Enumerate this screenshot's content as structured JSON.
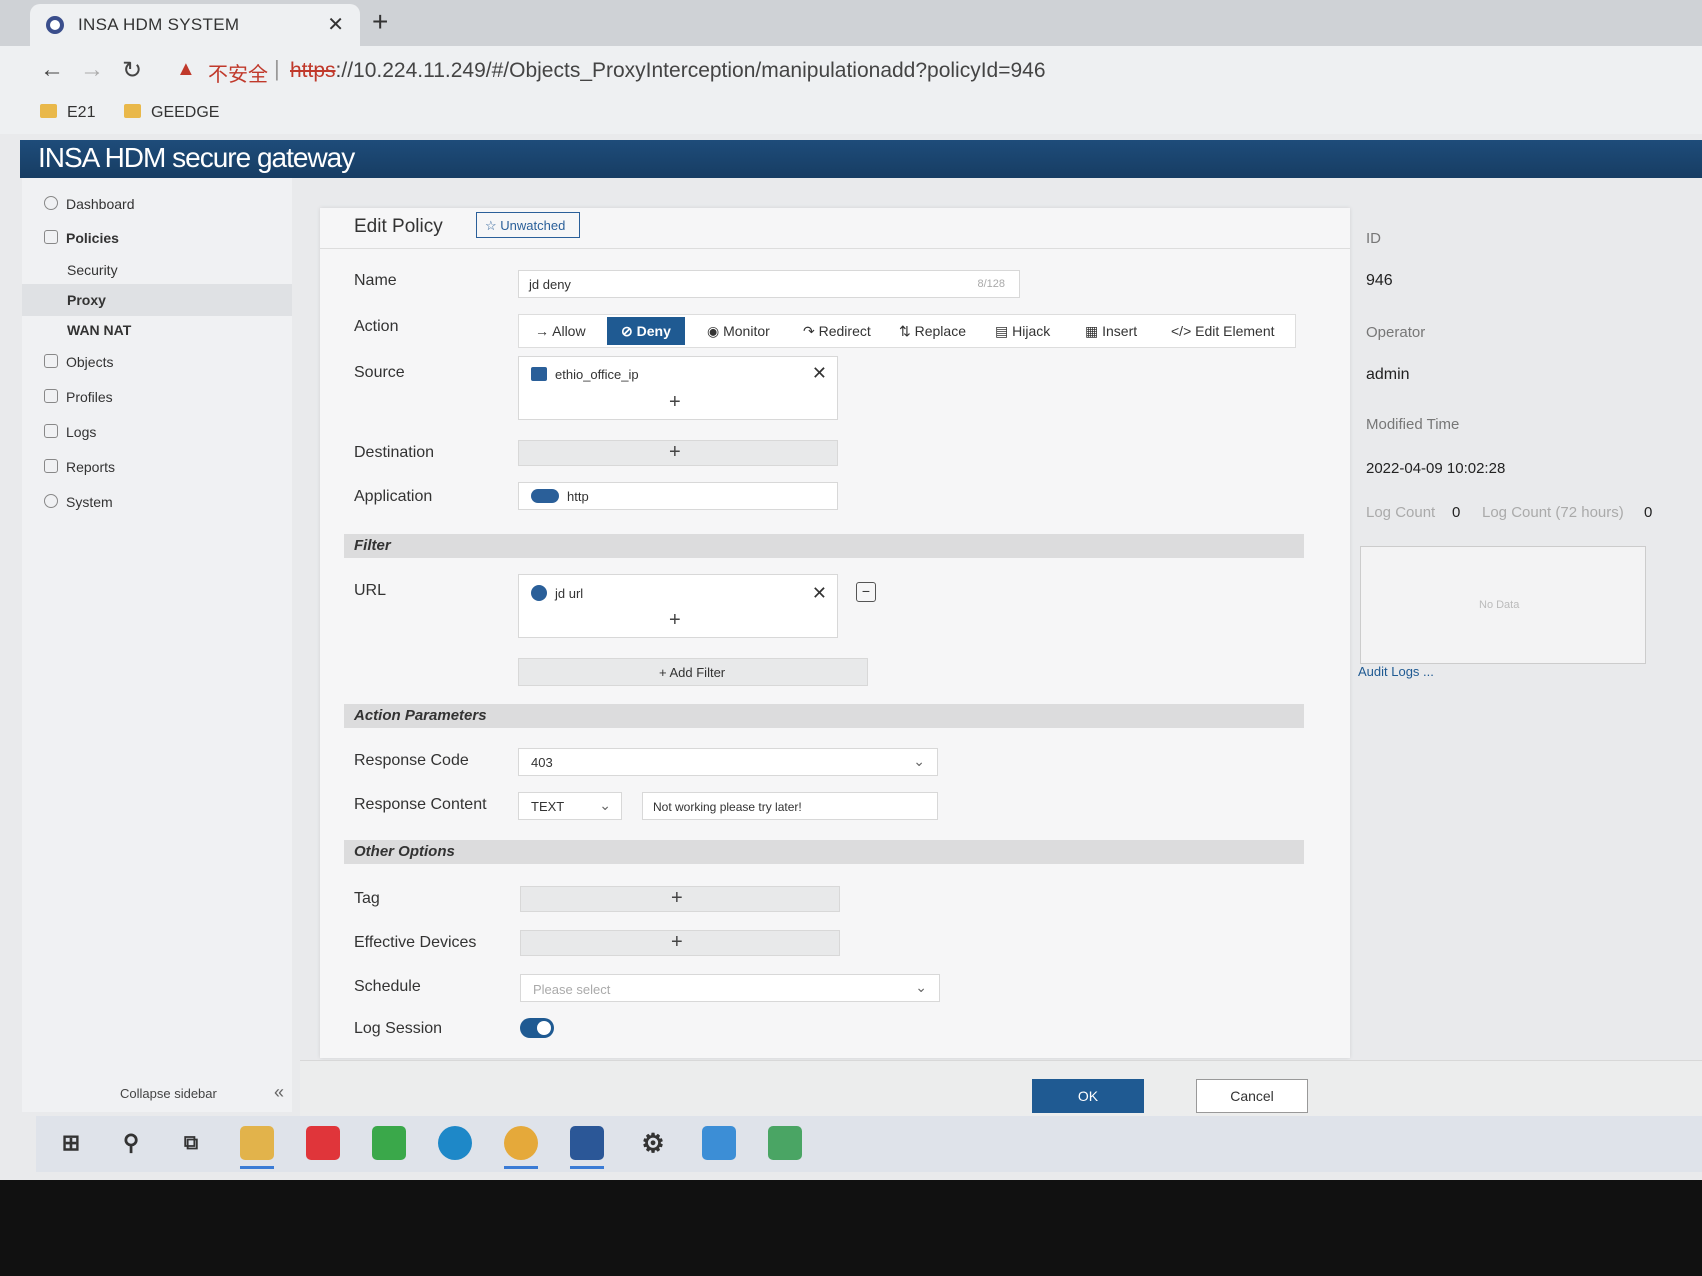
{
  "browser": {
    "tab_title": "INSA HDM SYSTEM",
    "warning": "▲",
    "insecure_label": "不安全",
    "url_scheme": "https",
    "url_rest": "://10.224.11.249/#/Objects_ProxyInterception/manipulationadd?policyId=946",
    "bookmarks": [
      "E21",
      "GEEDGE"
    ]
  },
  "app": {
    "title": "INSA HDM secure gateway"
  },
  "sidebar": {
    "items": [
      {
        "label": "Dashboard"
      },
      {
        "label": "Policies"
      },
      {
        "label": "Security"
      },
      {
        "label": "Proxy"
      },
      {
        "label": "WAN NAT"
      },
      {
        "label": "Objects"
      },
      {
        "label": "Profiles"
      },
      {
        "label": "Logs"
      },
      {
        "label": "Reports"
      },
      {
        "label": "System"
      }
    ],
    "collapse_label": "Collapse sidebar"
  },
  "form": {
    "title": "Edit Policy",
    "unwatched": "Unwatched",
    "name_label": "Name",
    "name_value": "jd deny",
    "name_count": "8/128",
    "action_label": "Action",
    "actions": [
      "Allow",
      "Deny",
      "Monitor",
      "Redirect",
      "Replace",
      "Hijack",
      "Insert",
      "Edit Element"
    ],
    "source_label": "Source",
    "source_value": "ethio_office_ip",
    "destination_label": "Destination",
    "application_label": "Application",
    "application_value": "http",
    "filter_section": "Filter",
    "url_label": "URL",
    "url_value": "jd url",
    "add_filter": "Add Filter",
    "action_params_section": "Action Parameters",
    "response_code_label": "Response Code",
    "response_code_value": "403",
    "response_content_label": "Response Content",
    "response_content_type": "TEXT",
    "response_content_value": "Not working please try later!",
    "other_section": "Other Options",
    "tag_label": "Tag",
    "devices_label": "Effective Devices",
    "schedule_label": "Schedule",
    "schedule_placeholder": "Please select",
    "log_session_label": "Log Session"
  },
  "info": {
    "id_label": "ID",
    "id_value": "946",
    "operator_label": "Operator",
    "operator_value": "admin",
    "modified_label": "Modified Time",
    "modified_value": "2022-04-09 10:02:28",
    "log_count_label": "Log Count",
    "log_count_value": "0",
    "log_count72_label": "Log Count (72 hours)",
    "log_count72_value": "0",
    "no_data": "No Data",
    "audit_logs": "Audit Logs ..."
  },
  "footer": {
    "ok": "OK",
    "cancel": "Cancel"
  },
  "colors": {
    "accent": "#1f5a92",
    "header": "#1e4c7a"
  }
}
